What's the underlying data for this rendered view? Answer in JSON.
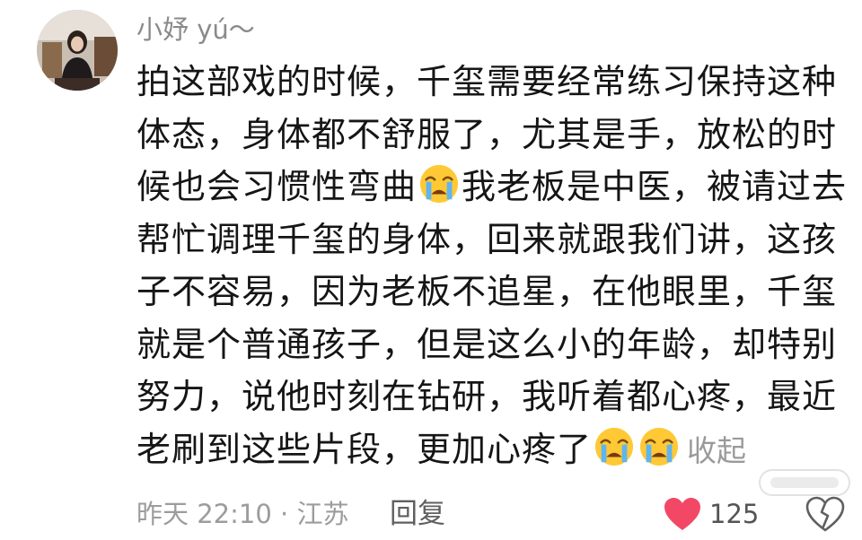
{
  "comment": {
    "username": "小妤 yú～",
    "content_lines": [
      "拍这部戏的时候，千玺需要经常练习保持这种",
      "体态，身体都不舒服了，尤其是手，放松的时",
      "候也会习惯性弯曲",
      "我老板是中医，被请过去",
      "帮忙调理千玺的身体，回来就跟我们讲，这孩",
      "子不容易，因为老板不追星，在他眼里，千玺",
      "就是个普通孩子，但是这么小的年龄，却特别",
      "努力，说他时刻在钻研，我听着都心疼，最近",
      "老刷到这些片段，更加心疼了"
    ],
    "collapse_label": "收起",
    "time_location": "昨天 22:10 · 江苏",
    "reply_label": "回复",
    "like_count": "125",
    "icons": {
      "emoji": "loudly-crying-face-icon",
      "like": "heart-icon",
      "dislike": "broken-heart-icon"
    },
    "colors": {
      "like_heart": "#f24866",
      "emoji_face": "#ffc936",
      "tears": "#5fb5f0"
    }
  }
}
